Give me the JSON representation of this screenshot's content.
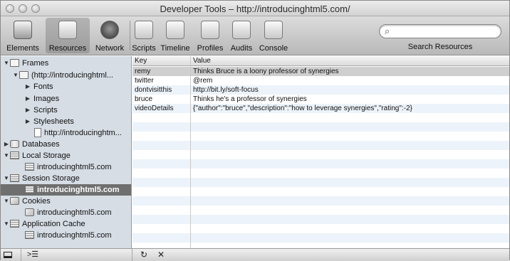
{
  "window": {
    "title": "Developer Tools – http://introducinghtml5.com/"
  },
  "toolbar": {
    "tools": [
      {
        "label": "Elements",
        "icon": "elements-icon"
      },
      {
        "label": "Resources",
        "icon": "resources-icon",
        "selected": true
      },
      {
        "label": "Network",
        "icon": "network-icon"
      },
      {
        "label": "Scripts",
        "icon": "scripts-icon"
      },
      {
        "label": "Timeline",
        "icon": "timeline-icon"
      },
      {
        "label": "Profiles",
        "icon": "profiles-icon"
      },
      {
        "label": "Audits",
        "icon": "audits-icon"
      },
      {
        "label": "Console",
        "icon": "console-icon"
      }
    ],
    "search_value": "",
    "search_label": "Search Resources"
  },
  "sidebar": {
    "items": [
      {
        "label": "Frames",
        "icon": "folder-icon",
        "disclosure": "▼"
      },
      {
        "label": "(http://introducinghtml...",
        "icon": "folder-icon",
        "disclosure": "▼"
      },
      {
        "label": "Fonts",
        "icon": "",
        "disclosure": "▶"
      },
      {
        "label": "Images",
        "icon": "",
        "disclosure": "▶"
      },
      {
        "label": "Scripts",
        "icon": "",
        "disclosure": "▶"
      },
      {
        "label": "Stylesheets",
        "icon": "",
        "disclosure": "▶"
      },
      {
        "label": "http://introducinghtm...",
        "icon": "document-icon",
        "disclosure": ""
      },
      {
        "label": "Databases",
        "icon": "database-icon",
        "disclosure": "▶"
      },
      {
        "label": "Local Storage",
        "icon": "storage-icon",
        "disclosure": "▼"
      },
      {
        "label": "introducinghtml5.com",
        "icon": "storage-icon",
        "disclosure": ""
      },
      {
        "label": "Session Storage",
        "icon": "storage-icon",
        "disclosure": "▼"
      },
      {
        "label": "introducinghtml5.com",
        "icon": "storage-icon",
        "disclosure": "",
        "selected": true
      },
      {
        "label": "Cookies",
        "icon": "cookie-icon",
        "disclosure": "▼"
      },
      {
        "label": "introducinghtml5.com",
        "icon": "cookie-icon",
        "disclosure": ""
      },
      {
        "label": "Application Cache",
        "icon": "storage-icon",
        "disclosure": "▼"
      },
      {
        "label": "introducinghtml5.com",
        "icon": "storage-icon",
        "disclosure": ""
      }
    ]
  },
  "table": {
    "columns": {
      "key": "Key",
      "value": "Value"
    },
    "rows": [
      {
        "key": "remy",
        "value": "Thinks Bruce is a loony professor of synergies"
      },
      {
        "key": "twitter",
        "value": "@rem"
      },
      {
        "key": "dontvisitthis",
        "value": "http://bit.ly/soft-focus"
      },
      {
        "key": "bruce",
        "value": "Thinks he's a professor of synergies"
      },
      {
        "key": "videoDetails",
        "value": "{\"author\":\"bruce\",\"description\":\"how to leverage synergies\",\"rating\":-2}"
      }
    ]
  },
  "bottombar": {
    "dock_icon": "dock-icon",
    "console_glyph": ">☰",
    "refresh_glyph": "↻",
    "delete_glyph": "✕"
  }
}
